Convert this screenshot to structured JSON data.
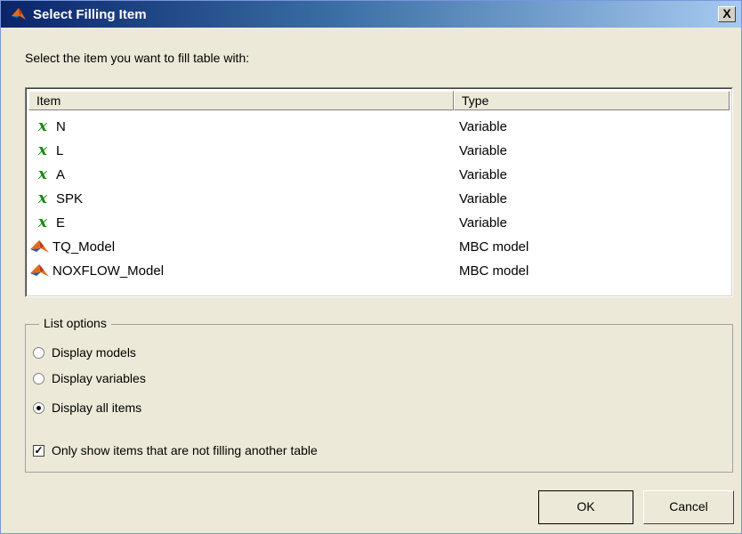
{
  "window": {
    "title": "Select Filling Item",
    "close_label": "X"
  },
  "prompt": "Select the item you want to fill table with:",
  "table": {
    "headers": {
      "item": "Item",
      "type": "Type"
    },
    "rows": [
      {
        "name": "N",
        "type": "Variable",
        "icon": "variable-icon"
      },
      {
        "name": "L",
        "type": "Variable",
        "icon": "variable-icon"
      },
      {
        "name": "A",
        "type": "Variable",
        "icon": "variable-icon"
      },
      {
        "name": "SPK",
        "type": "Variable",
        "icon": "variable-icon"
      },
      {
        "name": "E",
        "type": "Variable",
        "icon": "variable-icon"
      },
      {
        "name": "TQ_Model",
        "type": "MBC model",
        "icon": "matlab-model-icon"
      },
      {
        "name": "NOXFLOW_Model",
        "type": "MBC model",
        "icon": "matlab-model-icon"
      }
    ],
    "variable_glyph": "x"
  },
  "list_options": {
    "title": "List options",
    "radios": [
      {
        "label": "Display models",
        "selected": false
      },
      {
        "label": "Display variables",
        "selected": false
      },
      {
        "label": "Display all items",
        "selected": true
      }
    ],
    "checkbox": {
      "label": "Only show items that are not filling another table",
      "checked": true,
      "mark": "✓"
    }
  },
  "buttons": {
    "ok": "OK",
    "cancel": "Cancel"
  },
  "colors": {
    "title_start": "#0a246a",
    "title_end": "#a6caf0",
    "dialog_bg": "#ece9d8",
    "variable_green": "#1a8a1a"
  }
}
